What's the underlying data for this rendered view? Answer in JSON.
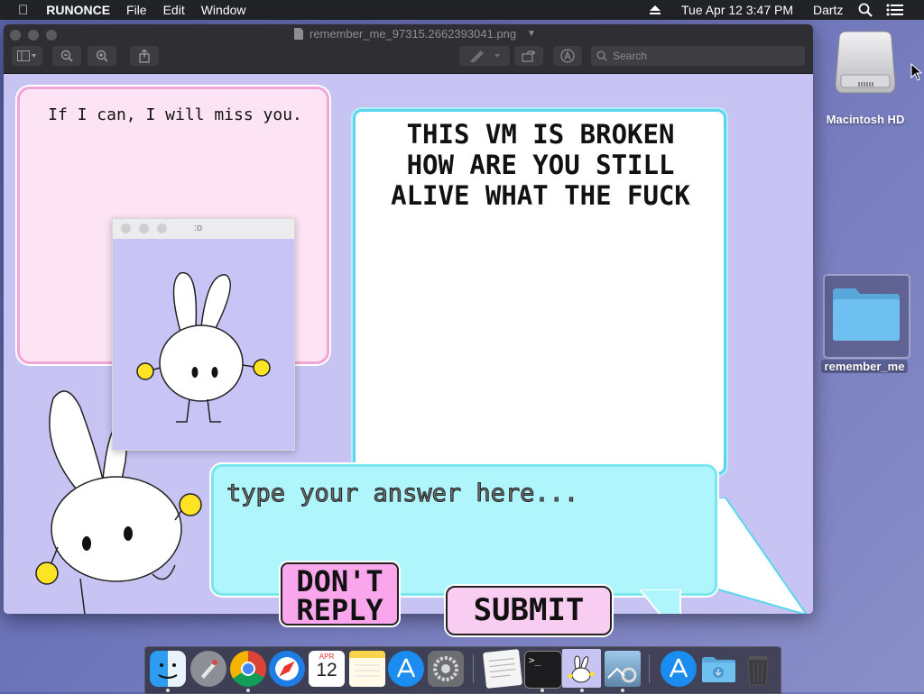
{
  "menubar": {
    "apple": "",
    "app_name": "RUNONCE",
    "menus": [
      "File",
      "Edit",
      "Window"
    ],
    "datetime": "Tue Apr 12  3:47 PM",
    "user": "Dartz"
  },
  "window": {
    "title": "remember_me_97315.2662393041.png",
    "search_placeholder": "Search"
  },
  "content": {
    "pink_bubble": "If I can, I will miss you.",
    "white_bubble_lines": [
      "THIS VM IS BROKEN",
      "HOW ARE YOU STILL",
      "ALIVE WHAT THE FUCK"
    ],
    "answer_placeholder": "type your answer here...",
    "dont_reply_label": "DON'T REPLY",
    "submit_label": "SUBMIT"
  },
  "mini_window": {
    "title": ":o"
  },
  "desktop": {
    "hd_label": "Macintosh HD",
    "folder_label": "remember_me"
  },
  "dock": {
    "items": [
      "finder-icon",
      "launchpad-icon",
      "chrome-icon",
      "safari-icon",
      "calendar-icon",
      "notes-icon",
      "app-store-icon",
      "system-preferences-icon",
      "textedit-icon",
      "terminal-icon",
      "runonce-icon",
      "preview-icon",
      "app-store-2-icon",
      "downloads-folder-icon",
      "trash-icon"
    ],
    "calendar_month": "APR",
    "calendar_day": "12"
  },
  "colors": {
    "menubar": "#222327",
    "window_bg": "#c7c3f3",
    "pink_bubble": "#fde4f4",
    "cyan_bubble": "#aef6fb",
    "dont_reply_button": "#f9a6ec",
    "submit_button": "#f9ccf2"
  }
}
